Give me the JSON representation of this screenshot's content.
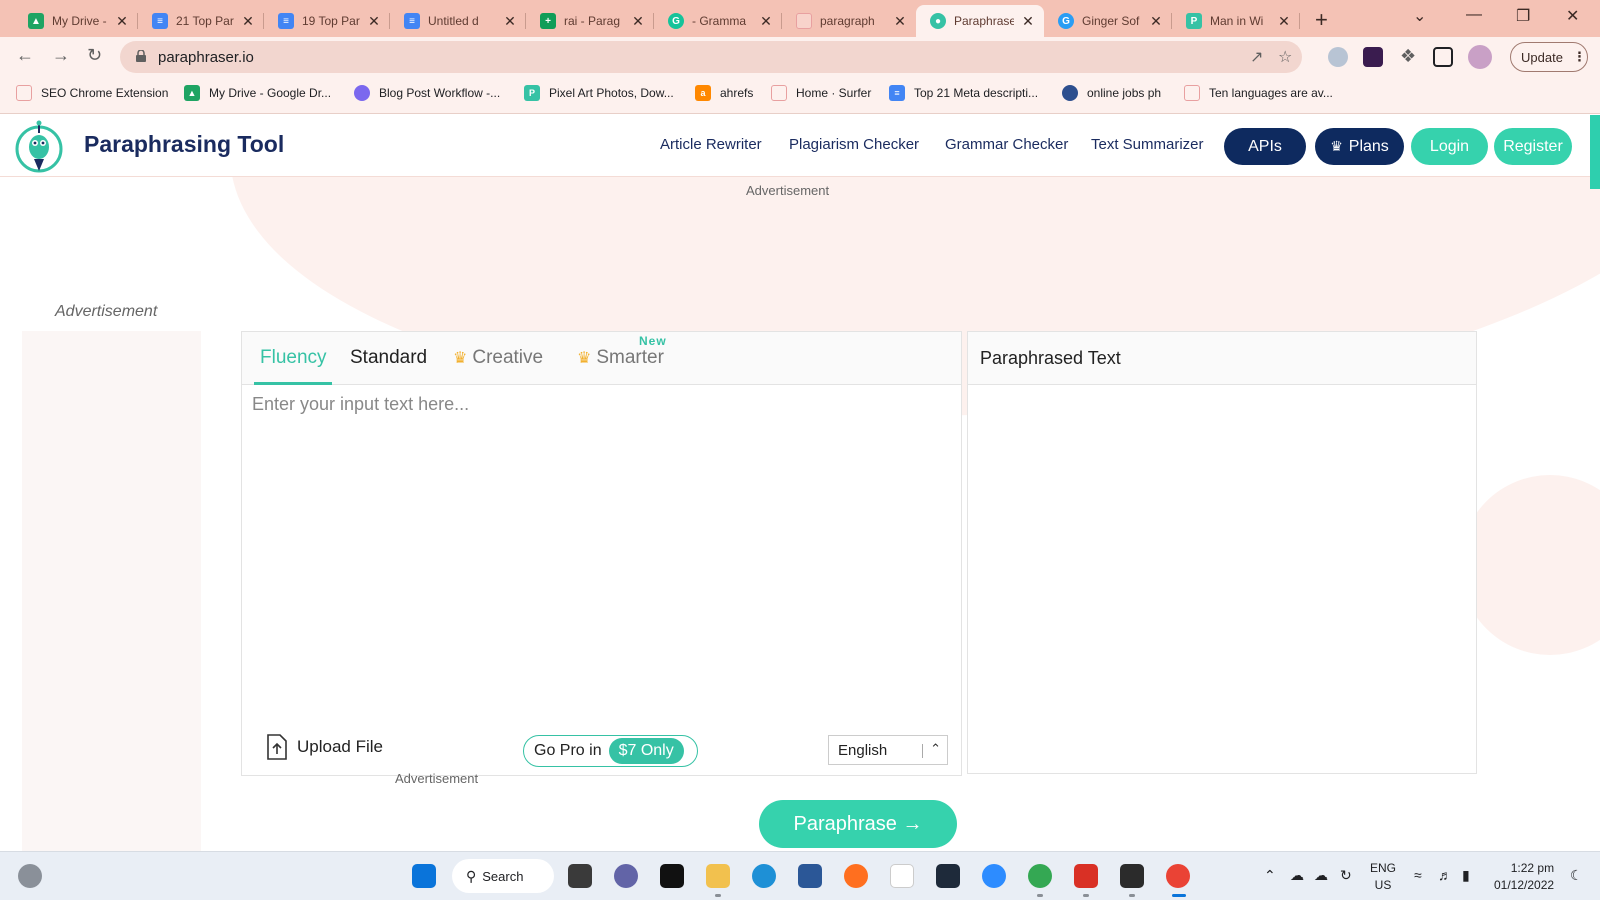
{
  "browser": {
    "tabs": [
      {
        "title": "My Drive -",
        "icon": "google-drive-icon",
        "color": "#1fa463"
      },
      {
        "title": "21 Top Par",
        "icon": "google-docs-icon",
        "color": "#4285f4"
      },
      {
        "title": "19 Top Par",
        "icon": "google-docs-icon",
        "color": "#4285f4"
      },
      {
        "title": "Untitled d",
        "icon": "google-docs-icon",
        "color": "#4285f4"
      },
      {
        "title": "rai - Parag",
        "icon": "google-sheets-plus-icon",
        "color": "#0f9d58"
      },
      {
        "title": "- Gramma",
        "icon": "grammarly-icon",
        "color": "#15c39a"
      },
      {
        "title": "paragraph",
        "icon": "page-icon",
        "color": "#e8a0a0"
      },
      {
        "title": "Paraphrase",
        "icon": "paraphraser-icon",
        "color": "#36c2a5"
      },
      {
        "title": "Ginger Sof",
        "icon": "ginger-icon",
        "color": "#2a9df4"
      },
      {
        "title": "Man in Wi",
        "icon": "paraphraser-p-icon",
        "color": "#36c2a5"
      }
    ],
    "active_tab": 7,
    "url": "paraphraser.io",
    "update_label": "Update",
    "bookmarks": [
      {
        "label": "SEO Chrome Extension",
        "icon": "seo-extension-icon",
        "color": "#e8a0a0"
      },
      {
        "label": "My Drive - Google Dr...",
        "icon": "google-drive-icon",
        "color": "#1fa463"
      },
      {
        "label": "Blog Post Workflow -...",
        "icon": "clickup-icon",
        "color": "#7b68ee"
      },
      {
        "label": "Pixel Art Photos, Dow...",
        "icon": "pixel-art-icon",
        "color": "#36c2a5"
      },
      {
        "label": "ahrefs",
        "icon": "ahrefs-icon",
        "color": "#ff8800"
      },
      {
        "label": "Home · Surfer",
        "icon": "surfer-icon",
        "color": "#e8a0a0"
      },
      {
        "label": "Top 21 Meta descripti...",
        "icon": "google-docs-icon",
        "color": "#4285f4"
      },
      {
        "label": "online jobs ph",
        "icon": "onlinejobs-icon",
        "color": "#2d4f8e"
      },
      {
        "label": "Ten languages are av...",
        "icon": "page-icon",
        "color": "#e8a0a0"
      }
    ]
  },
  "site": {
    "brand": "Paraphrasing Tool",
    "nav": [
      "Article Rewriter",
      "Plagiarism Checker",
      "Grammar Checker",
      "Text Summarizer"
    ],
    "apis_label": "APIs",
    "plans_label": "Plans",
    "login_label": "Login",
    "register_label": "Register",
    "ad_label": "Advertisement",
    "ad_left_label": "Advertisement",
    "ad_bottom_label": "Advertisement"
  },
  "editor": {
    "modes": [
      "Fluency",
      "Standard",
      "Creative",
      "Smarter"
    ],
    "active_mode": "Fluency",
    "new_badge": "New",
    "placeholder": "Enter your input text here...",
    "upload_label": "Upload File",
    "gopro_label": "Go Pro in",
    "gopro_price": "$7 Only",
    "language": "English",
    "output_title": "Paraphrased Text",
    "paraphrase_label": "Paraphrase →"
  },
  "taskbar": {
    "search_label": "Search",
    "lang_line1": "ENG",
    "lang_line2": "US",
    "time": "1:22 pm",
    "date": "01/12/2022"
  },
  "colors": {
    "accent": "#36c2a5",
    "navy": "#0e2a5f",
    "tab_strip": "#f4c2b5"
  }
}
